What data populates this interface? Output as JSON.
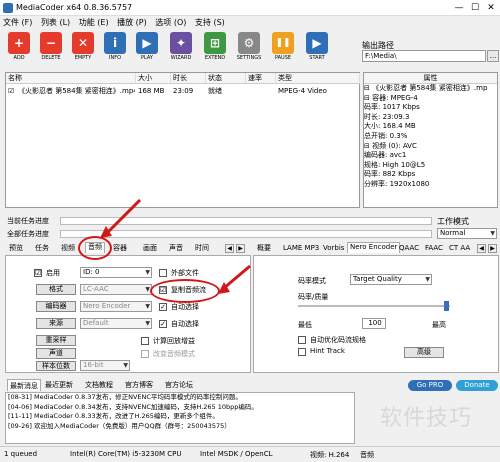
{
  "window": {
    "title": "MediaCoder x64 0.8.36.5757",
    "minimize": "—",
    "maximize": "☐",
    "close": "✕"
  },
  "menu": [
    "文件 (F)",
    "列表 (L)",
    "功能 (E)",
    "播放 (P)",
    "选项 (O)",
    "支持 (S)"
  ],
  "toolbar": [
    {
      "label": "ADD",
      "color": "#e53b2b",
      "glyph": "+"
    },
    {
      "label": "DELETE",
      "color": "#e53b2b",
      "glyph": "−"
    },
    {
      "label": "EMPTY",
      "color": "#e53b2b",
      "glyph": "✕"
    },
    {
      "label": "INFO",
      "color": "#2f6fb5",
      "glyph": "i"
    },
    {
      "label": "PLAY",
      "color": "#2f6fb5",
      "glyph": "▶"
    },
    {
      "label": "WIZARD",
      "color": "#6b4fa0",
      "glyph": "✦"
    },
    {
      "label": "EXTEND",
      "color": "#3d9a42",
      "glyph": "⊞"
    },
    {
      "label": "SETTINGS",
      "color": "#888888",
      "glyph": "⚙"
    },
    {
      "label": "PAUSE",
      "color": "#f0a020",
      "glyph": "❚❚"
    },
    {
      "label": "START",
      "color": "#2f6fb5",
      "glyph": "▶"
    }
  ],
  "output": {
    "label": "输出路径",
    "path": "F:\\Media\\",
    "browse": "..."
  },
  "filelist": {
    "headers": [
      "名称",
      "大小",
      "时长",
      "状态",
      "速率",
      "类型"
    ],
    "rows": [
      {
        "checked": "☑",
        "name": "《火影忍者 第584集 紧密相连》.mp4",
        "size": "168 MB",
        "duration": "23:09",
        "status": "就绪",
        "rate": "",
        "type": "MPEG-4 Video"
      }
    ]
  },
  "properties": {
    "header": "属性",
    "items": [
      "⊟ 《火影忍者 第584集 紧密相连》.mp",
      "  ⊟ 容器: MPEG-4",
      "      码率: 1017 Kbps",
      "      时长: 23:09.3",
      "      大小: 168.4 MB",
      "      总开销: 0.3%",
      "  ⊟ 视频 (0): AVC",
      "      编码器: avc1",
      "      规格: High 10@L5",
      "      码率: 882 Kbps",
      "      分辨率: 1920x1080"
    ]
  },
  "progress": {
    "current": "当前任务进度",
    "all": "全部任务进度"
  },
  "worktype": {
    "label": "工作模式",
    "value": "Normal"
  },
  "tabs_left": [
    "预览",
    "任务",
    "视频",
    "音频",
    "容器",
    "画面",
    "声音",
    "时间"
  ],
  "tabs_right": [
    "概要",
    "LAME MP3",
    "Vorbis",
    "Nero Encoder",
    "QAAC",
    "FAAC",
    "CT AA"
  ],
  "audio": {
    "enable_label": "启用",
    "enable_check": "☑",
    "track_value": "ID: 0",
    "external_file": "外部文件",
    "format_btn": "格式",
    "format_value": "LC-AAC",
    "copy_audio": "复制音频流",
    "copy_check": "☑",
    "encoder_btn": "编码器",
    "encoder_value": "Nero Encoder",
    "auto_select1": "自动选择",
    "source_btn": "来源",
    "source_value": "Default",
    "auto_select2": "自动选择",
    "resample_btn": "重采样",
    "channels_btn": "声道",
    "bitdepth_btn": "样本位数",
    "bitdepth_value": "16-bit",
    "calc_gain": "计算回放增益",
    "change_volume": "改变音频模式"
  },
  "rate_panel": {
    "mode_label": "码率模式",
    "mode_value": "Target Quality",
    "quality_label": "码率/质量",
    "min_label": "最低",
    "max_label": "最高",
    "quality_value": "100",
    "optimize": "自动优化码流规格",
    "hint_track": "Hint Track",
    "advanced_btn": "高级"
  },
  "news_tabs": [
    "最新消息",
    "最近更新",
    "文档教程",
    "官方博客",
    "官方论坛"
  ],
  "news_buttons": {
    "gopro": "Go PRO",
    "donate": "Donate"
  },
  "news": [
    "[08-31] MediaCoder 0.8.37发布，修正NVENC平均码率模式的码率控制问题。",
    "[04-06] MediaCoder 0.8.34发布，支持NVENC加速编码，支持H.265 10bpp编码。",
    "[11-11] MediaCoder 0.8.33发布，改进了H.265编码，更新多个组件。",
    "[09-26] 欢迎加入MediaCoder（免费版）用户QQ群（群号：250043575）"
  ],
  "status": {
    "queued": "1 queued",
    "cpu": "Intel(R) Core(TM) i5-3230M CPU",
    "gpu": "Intel MSDK / OpenCL",
    "video": "视频: H.264",
    "audio": "音频"
  },
  "watermark": "软件技巧"
}
